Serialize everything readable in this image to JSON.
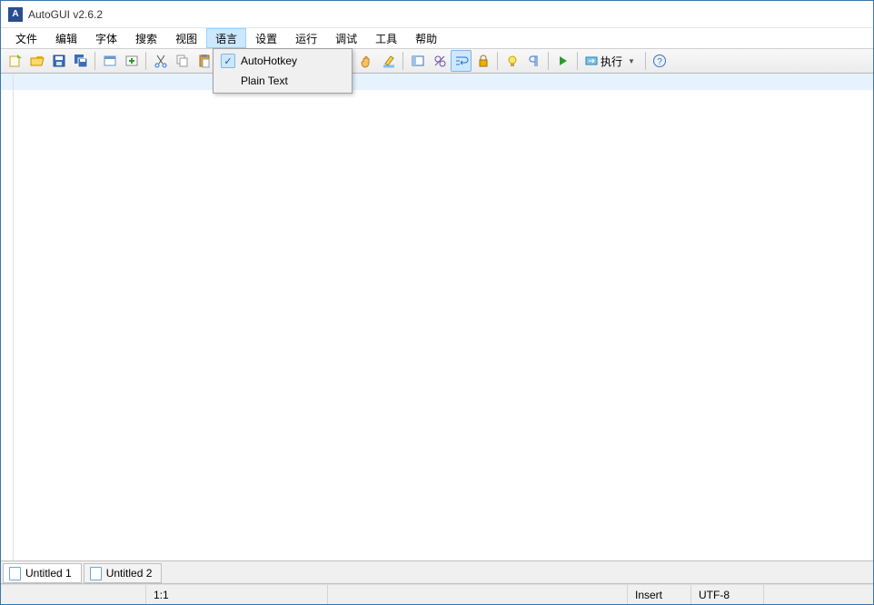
{
  "title": "AutoGUI v2.6.2",
  "menu": {
    "file": "文件",
    "edit": "编辑",
    "font": "字体",
    "search": "搜索",
    "view": "视图",
    "language": "语言",
    "settings": "设置",
    "run": "运行",
    "debug": "调试",
    "tools": "工具",
    "help": "帮助"
  },
  "language_menu": {
    "autohotkey": "AutoHotkey",
    "plaintext": "Plain Text"
  },
  "toolbar": {
    "run_label": "执行"
  },
  "tabs": [
    "Untitled 1",
    "Untitled 2"
  ],
  "status": {
    "pos": "1:1",
    "insert": "Insert",
    "encoding": "UTF-8"
  }
}
